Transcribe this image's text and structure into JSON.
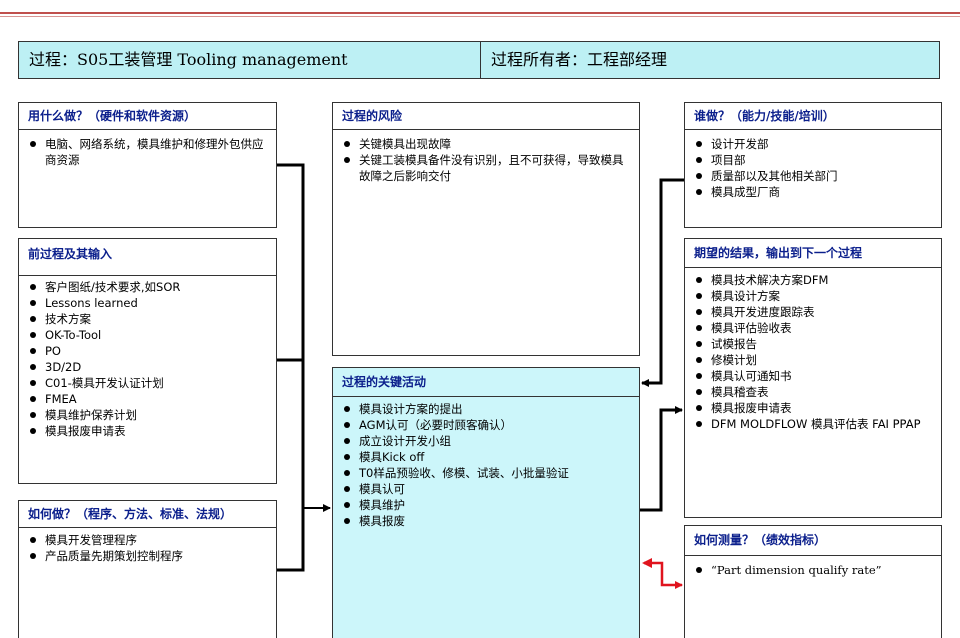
{
  "header": {
    "process": "过程：S05工装管理 Tooling management",
    "owner": "过程所有者：工程部经理"
  },
  "boxes": {
    "with_what": {
      "title": "用什么做？（硬件和软件资源）",
      "items": [
        "电脑、网络系统，模具维护和修理外包供应商资源"
      ]
    },
    "risk": {
      "title": "过程的风险",
      "items": [
        "关键模具出现故障",
        "关键工装模具备件没有识别，且不可获得，导致模具故障之后影响交付"
      ]
    },
    "who": {
      "title": "谁做？（能力/技能/培训）",
      "items": [
        "设计开发部",
        "项目部",
        "质量部以及其他相关部门",
        "模具成型厂商"
      ]
    },
    "pre_process": {
      "title": "前过程及其输入",
      "items": [
        "客户图纸/技术要求,如SOR",
        "Lessons learned",
        "技术方案",
        "OK-To-Tool",
        "PO",
        "3D/2D",
        "C01-模具开发认证计划",
        "FMEA",
        "模具维护保养计划",
        "模具报废申请表"
      ]
    },
    "expected": {
      "title": "期望的结果，输出到下一个过程",
      "items": [
        "模具技术解决方案DFM",
        "模具设计方案",
        "模具开发进度跟踪表",
        "模具评估验收表",
        "试模报告",
        "修模计划",
        "模具认可通知书",
        "模具稽查表",
        "模具报废申请表",
        "DFM MOLDFLOW 模具评估表 FAI PPAP"
      ]
    },
    "key_activities": {
      "title": "过程的关键活动",
      "items": [
        "模具设计方案的提出",
        "AGM认可（必要时顾客确认）",
        "成立设计开发小组",
        "模具Kick off",
        "T0样品预验收、修模、试装、小批量验证",
        "模具认可",
        "模具维护",
        "模具报废"
      ]
    },
    "how": {
      "title": "如何做？（程序、方法、标准、法规）",
      "items": [
        "模具开发管理程序",
        "产品质量先期策划控制程序"
      ]
    },
    "measure": {
      "title": "如何测量？（绩效指标）",
      "items": [
        "“Part dimension qualify rate”"
      ]
    }
  },
  "colors": {
    "title_text": "#0b1f8c",
    "header_fill": "#bdf0f4",
    "activity_fill": "#ccf6fa",
    "connector": "#000000",
    "measure_connector": "#e0141e",
    "top_rule": "#c0504d"
  }
}
